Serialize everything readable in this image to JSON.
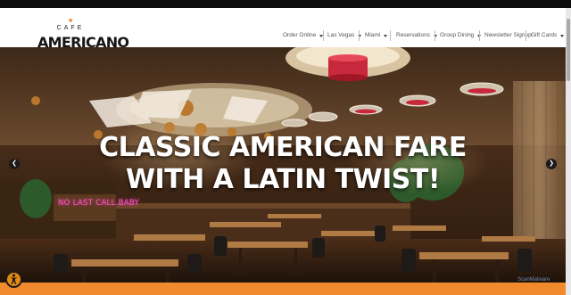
{
  "brand": {
    "cafe": "CAFE",
    "name": "AMERICANO"
  },
  "nav": {
    "items": [
      {
        "label": "Order Online",
        "dropdown": true
      },
      {
        "label": "Las Vegas",
        "dropdown": true
      },
      {
        "label": "Miami",
        "dropdown": true
      },
      {
        "label": "Reservations",
        "dropdown": true
      },
      {
        "label": "Group Dining",
        "dropdown": true
      },
      {
        "label": "Newsletter Signup",
        "dropdown": false
      },
      {
        "label": "Gift Cards",
        "dropdown": true
      }
    ]
  },
  "hero": {
    "line1": "CLASSIC AMERICAN FARE",
    "line2": "WITH A LATIN TWIST!",
    "neon_sign": "NO LAST CALL BABY"
  },
  "slider": {
    "prev_icon": "chevron-left-icon",
    "next_icon": "chevron-right-icon"
  },
  "watermark": "ScanMalware",
  "colors": {
    "accent": "#f08a2c",
    "logo_star": "#e8731c",
    "neon": "#ff57c8"
  }
}
